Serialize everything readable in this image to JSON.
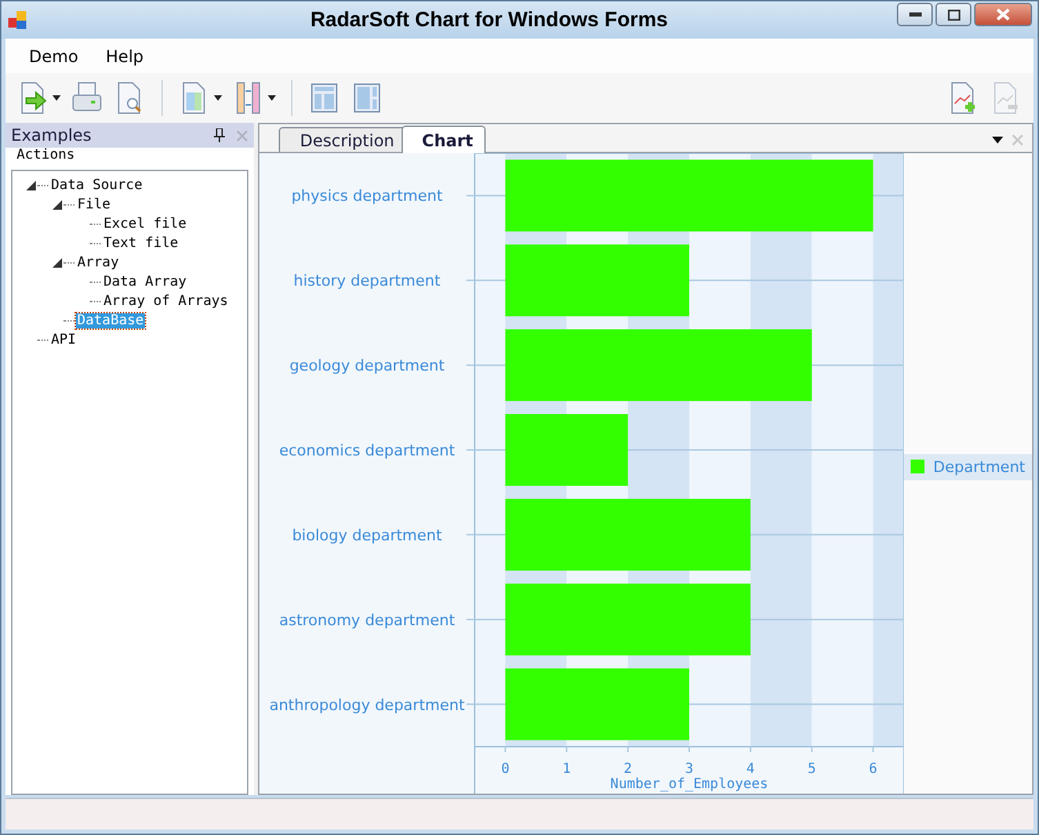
{
  "window": {
    "title": "RadarSoft Chart for Windows Forms"
  },
  "menu": [
    "Demo",
    "Help"
  ],
  "toolbar": [
    {
      "kind": "export",
      "dropdown": true,
      "disabled": false
    },
    {
      "kind": "print",
      "dropdown": false,
      "disabled": false
    },
    {
      "kind": "preview",
      "dropdown": false,
      "disabled": false
    },
    {
      "kind": "separator"
    },
    {
      "kind": "rows",
      "dropdown": true,
      "disabled": false
    },
    {
      "kind": "columns",
      "dropdown": true,
      "disabled": false
    },
    {
      "kind": "separator"
    },
    {
      "kind": "layout-left",
      "dropdown": false,
      "disabled": false
    },
    {
      "kind": "layout-right",
      "dropdown": false,
      "disabled": false
    },
    {
      "kind": "spacer"
    },
    {
      "kind": "add-chart",
      "dropdown": false,
      "disabled": false
    },
    {
      "kind": "remove-chart",
      "dropdown": false,
      "disabled": true
    }
  ],
  "panel": {
    "title": "Examples",
    "group": "Actions",
    "tree": [
      {
        "label": "Data Source",
        "selected": false,
        "expanded": true,
        "children": [
          {
            "label": "File",
            "selected": false,
            "expanded": true,
            "children": [
              {
                "label": "Excel file",
                "selected": false
              },
              {
                "label": "Text file",
                "selected": false
              }
            ]
          },
          {
            "label": "Array",
            "selected": false,
            "expanded": true,
            "children": [
              {
                "label": "Data Array",
                "selected": false
              },
              {
                "label": "Array of Arrays",
                "selected": false
              }
            ]
          },
          {
            "label": "DataBase",
            "selected": true
          }
        ]
      },
      {
        "label": "API",
        "selected": false
      }
    ]
  },
  "document_tabs": [
    {
      "label": "Description",
      "selected": false
    },
    {
      "label": "Chart",
      "selected": true
    }
  ],
  "chart": {
    "chart_data": {
      "type": "bar",
      "orientation": "horizontal",
      "xlabel": "Number_of_Employees",
      "categories": [
        "physics department",
        "history department",
        "geology department",
        "economics department",
        "biology department",
        "astronomy department",
        "anthropology department"
      ],
      "series": [
        {
          "name": "Department",
          "color": "#33ff00",
          "values": [
            6,
            3,
            5,
            2,
            4,
            4,
            3
          ]
        }
      ],
      "grid": true,
      "xlim": [
        -0.5,
        6.5
      ],
      "xticks": [
        0,
        1,
        2,
        3,
        4,
        5,
        6
      ]
    }
  }
}
